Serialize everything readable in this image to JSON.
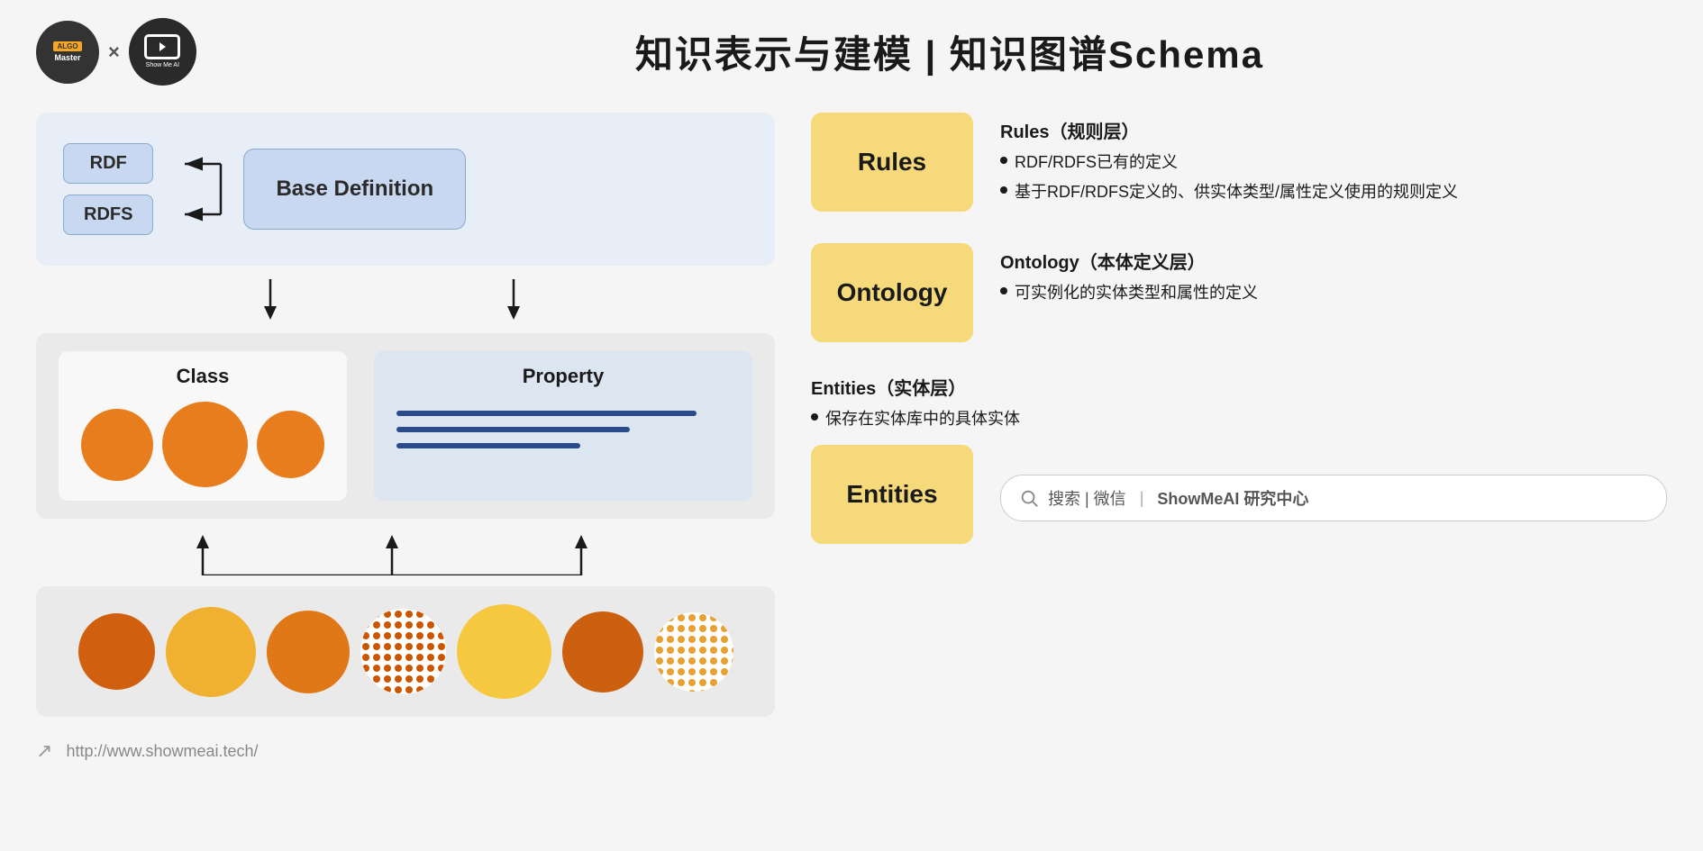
{
  "header": {
    "title": "知识表示与建模 | 知识图谱Schema",
    "algo_line1": "ALGO",
    "algo_line2": "Master",
    "showme_text": "Show Me AI",
    "x_symbol": "×"
  },
  "diagram": {
    "rdf_label": "RDF",
    "rdfs_label": "RDFS",
    "base_definition_label": "Base Definition",
    "class_label": "Class",
    "property_label": "Property"
  },
  "info": {
    "rules_badge": "Rules",
    "rules_heading": "Rules（规则层）",
    "rules_bullet1": "RDF/RDFS已有的定义",
    "rules_bullet2": "基于RDF/RDFS定义的、供实体类型/属性定义使用的规则定义",
    "ontology_badge": "Ontology",
    "ontology_heading": "Ontology（本体定义层）",
    "ontology_bullet1": "可实例化的实体类型和属性的定义",
    "entities_badge": "Entities",
    "entities_heading": "Entities（实体层）",
    "entities_bullet1": "保存在实体库中的具体实体",
    "search_placeholder": "搜索 | 微信",
    "search_bold": "ShowMeAI 研究中心"
  },
  "footer": {
    "url": "http://www.showmeai.tech/"
  }
}
